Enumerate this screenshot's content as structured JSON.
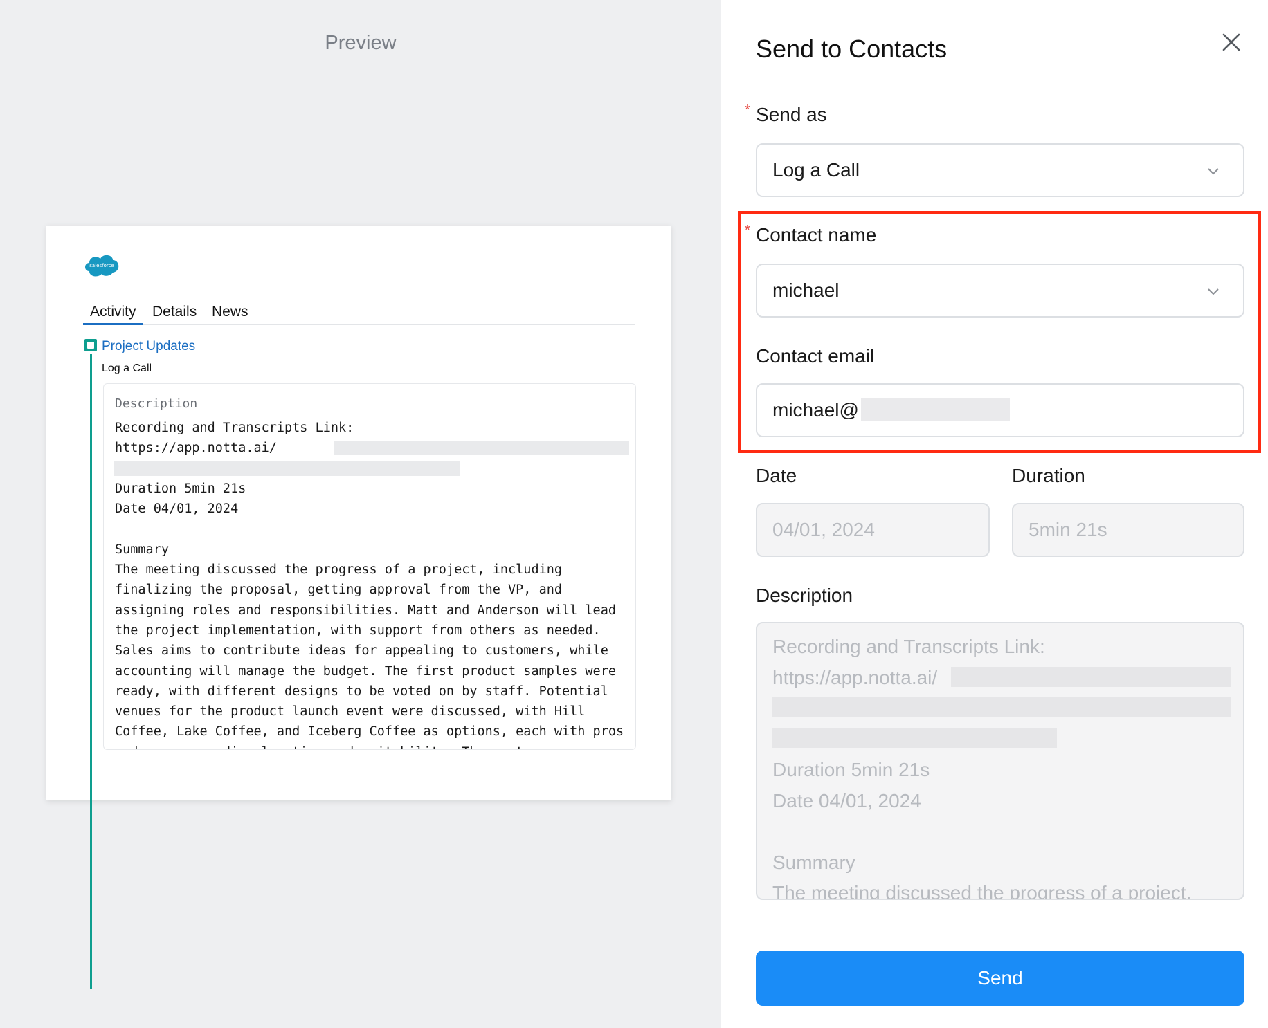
{
  "preview": {
    "title": "Preview",
    "logo_text": "salesforce",
    "tabs": [
      "Activity",
      "Details",
      "News"
    ],
    "activity": {
      "title": "Project Updates",
      "type": "Log a Call",
      "description_label": "Description",
      "description_text": "Recording and Transcripts Link:\nhttps://app.notta.ai/\n\nDuration 5min 21s\nDate 04/01, 2024\n\nSummary\nThe meeting discussed the progress of a project, including finalizing the proposal, getting approval from the VP, and assigning roles and responsibilities. Matt and Anderson will lead the project implementation, with support from others as needed. Sales aims to contribute ideas for appealing to customers, while accounting will manage the budget. The first product samples were ready, with different designs to be voted on by staff. Potential venues for the product launch event were discussed, with Hill Coffee, Lake Coffee, and Iceberg Coffee as options, each with pros and cons regarding location and suitability. The next"
    }
  },
  "panel": {
    "title": "Send to Contacts",
    "send_as": {
      "label": "Send as",
      "value": "Log a Call"
    },
    "contact_name": {
      "label": "Contact name",
      "value": "michael"
    },
    "contact_email": {
      "label": "Contact email",
      "value": "michael@"
    },
    "date": {
      "label": "Date",
      "value": "04/01, 2024"
    },
    "duration": {
      "label": "Duration",
      "value": "5min 21s"
    },
    "description": {
      "label": "Description",
      "value": "Recording and Transcripts Link:\nhttps://app.notta.ai/\n\n\nDuration 5min 21s\nDate 04/01, 2024\n\nSummary\nThe meeting discussed the progress of a project,"
    },
    "send_label": "Send"
  },
  "colors": {
    "accent": "#1a8cf7",
    "highlight": "#ff2a12",
    "required": "#e5413a",
    "activity": "#0e9e8f",
    "link": "#1b6ec2"
  }
}
